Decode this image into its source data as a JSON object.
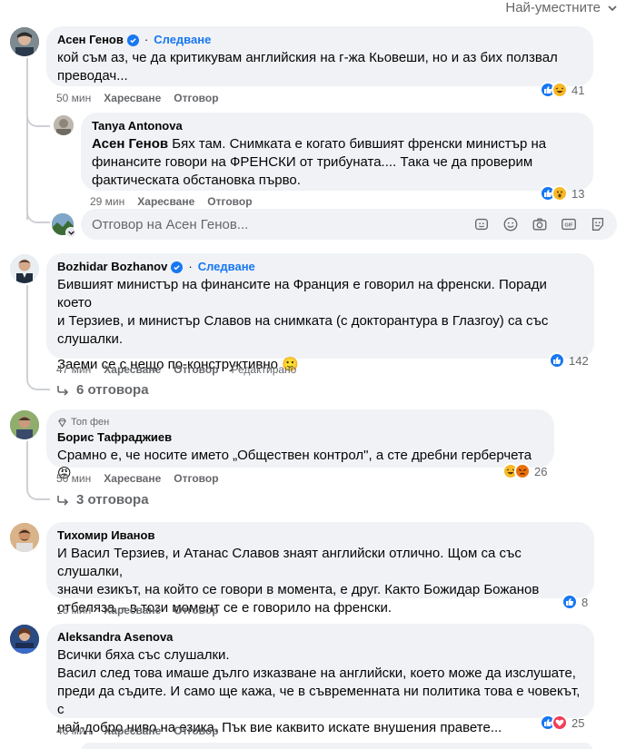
{
  "sort": {
    "label": "Най-уместните"
  },
  "comments": [
    {
      "author": "Асен Генов",
      "verified": true,
      "follow": "Следване",
      "lines": [
        "кой съм аз, че да критикувам английския на г-жа Кьовеши, но и аз бих ползвал",
        "преводач..."
      ],
      "time": "50 мин",
      "like": "Харесване",
      "reply": "Отговор",
      "reactions": {
        "icons": [
          "like",
          "haha"
        ],
        "count": "41"
      },
      "replies": [
        {
          "author": "Tanya Antonova",
          "mention": "Асен Генов",
          "lines": [
            "Бях там. Снимката е когато бившият френски министър на",
            "финансите говори на ФРЕНСКИ от трибуната.... Така че да проверим",
            "фактическата обстановка първо."
          ],
          "time": "29 мин",
          "like": "Харесване",
          "reply": "Отговор",
          "reactions": {
            "icons": [
              "like",
              "wow"
            ],
            "count": "13"
          }
        }
      ],
      "reply_box": {
        "placeholder": "Отговор на Асен Генов..."
      }
    },
    {
      "author": "Bozhidar Bozhanov",
      "verified": true,
      "follow": "Следване",
      "lines": [
        "Бившият министър на финансите на Франция е говорил на френски. Поради което",
        "и Терзиев, и министър Славов на снимката (с докторантура в Глазгоу) са със",
        "слушалки."
      ],
      "lines2": [
        "Заеми се с нещо по-конструктивно 🙂"
      ],
      "time": "47 мин",
      "like": "Харесване",
      "reply": "Отговор",
      "edited": "Редактирано",
      "reactions": {
        "icons": [
          "like"
        ],
        "count": "142"
      },
      "replies_link": "6 отговора"
    },
    {
      "badge": "Топ фен",
      "author": "Борис Тафраджиев",
      "lines": [
        "Срамно е, че носите името „Обществен контрол\", а сте дребни герберчета😡"
      ],
      "time": "50 мин",
      "like": "Харесване",
      "reply": "Отговор",
      "reactions": {
        "icons": [
          "haha",
          "angry"
        ],
        "count": "26"
      },
      "replies_link": "3 отговора"
    },
    {
      "author": "Тихомир Иванов",
      "lines": [
        "И Васил Терзиев, и Атанас Славов знаят английски отлично. Щом са със слушалки,",
        "значи езикът, на който се говори в момента, е друг. Както Божидар Божанов",
        "отбеляза – в този момент се е говорило на френски."
      ],
      "time": "16 мин",
      "like": "Харесване",
      "reply": "Отговор",
      "reactions": {
        "icons": [
          "like"
        ],
        "count": "8"
      }
    },
    {
      "author": "Aleksandra Asenova",
      "lines": [
        "Всички бяха със слушалки.",
        "Васил след това имаше дълго изказване на английски, което може да изслушате,",
        "преди да съдите. И само ще кажа, че в съвременната ни политика това е човекът, с",
        "най-добро ниво на езика. Пък вие каквито искате внушения правете..."
      ],
      "time": "46 мин",
      "like": "Харесване",
      "reply": "Отговор",
      "reactions": {
        "icons": [
          "like",
          "love"
        ],
        "count": "25"
      }
    }
  ],
  "colors": {
    "accent": "#1877f2",
    "bubble": "#f0f2f5",
    "muted": "#65676b",
    "thread": "#ced0d4"
  }
}
